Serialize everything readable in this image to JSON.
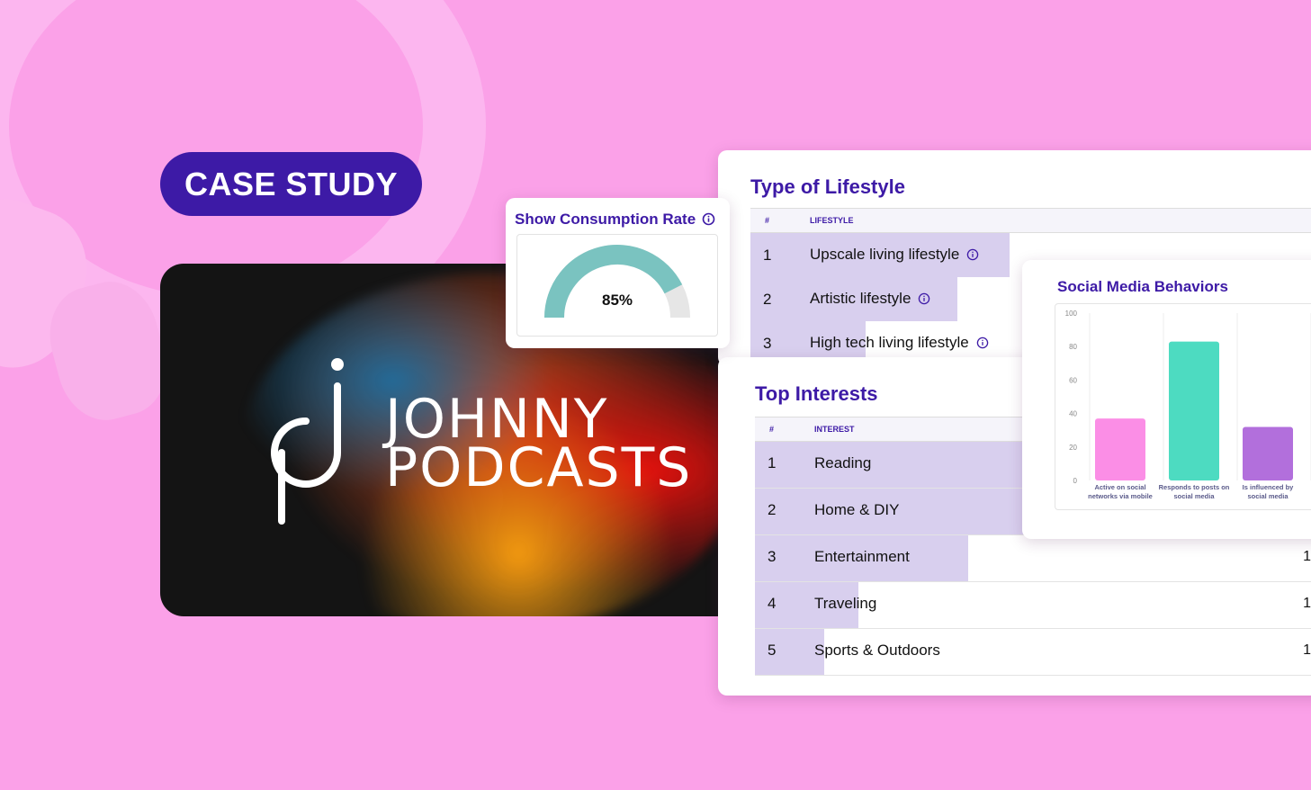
{
  "badge": {
    "label": "CASE STUDY"
  },
  "hero": {
    "brand_line1": "JOHNNY",
    "brand_line2": "PODCASTS"
  },
  "consumption": {
    "title": "Show Consumption Rate",
    "value_label": "85%",
    "value": 85,
    "color": "#7ac3c0",
    "track_color": "#e6e6e6"
  },
  "lifestyle": {
    "title": "Type of Lifestyle",
    "col_num": "#",
    "col_label": "LIFESTYLE",
    "rows": [
      {
        "num": "1",
        "label": "Upscale living lifestyle",
        "share": 0.45
      },
      {
        "num": "2",
        "label": "Artistic lifestyle",
        "share": 0.36
      },
      {
        "num": "3",
        "label": "High tech living lifestyle",
        "share": 0.2
      }
    ]
  },
  "interests": {
    "title": "Top Interests",
    "col_num": "#",
    "col_label": "INTEREST",
    "rows": [
      {
        "num": "1",
        "label": "Reading",
        "count": "",
        "share": 0.55
      },
      {
        "num": "2",
        "label": "Home & DIY",
        "count": "",
        "share": 0.48
      },
      {
        "num": "3",
        "label": "Entertainment",
        "count": "1",
        "share": 0.37
      },
      {
        "num": "4",
        "label": "Traveling",
        "count": "1",
        "share": 0.18
      },
      {
        "num": "5",
        "label": "Sports & Outdoors",
        "count": "1",
        "share": 0.12
      }
    ]
  },
  "social": {
    "title": "Social Media Behaviors",
    "chart_data": {
      "type": "bar",
      "categories": [
        [
          "Active on social",
          "networks via mobile"
        ],
        [
          "Responds to posts on",
          "social media"
        ],
        [
          "Is influenced by",
          "social media"
        ]
      ],
      "values": [
        37,
        83,
        32
      ],
      "colors": [
        "#fb8ee6",
        "#4ddbc1",
        "#b26fdc"
      ],
      "yticks": [
        "0",
        "20",
        "40",
        "60",
        "80",
        "100"
      ],
      "ylim": [
        0,
        100
      ]
    }
  }
}
